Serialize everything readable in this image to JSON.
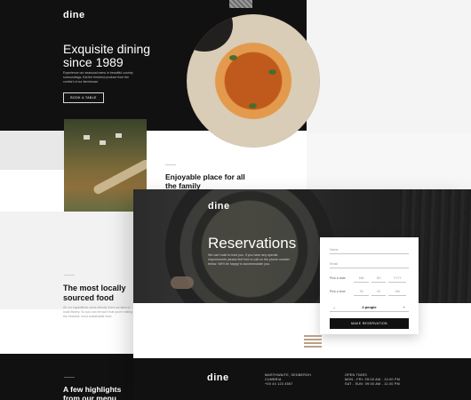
{
  "home": {
    "logo": "dine",
    "hero_title": "Exquisite dining since 1989",
    "hero_description": "Experience our seasonal menu in beautiful country surroundings. Eat the freshest produce from the comfort of our farmhouse.",
    "book_button": "BOOK A TABLE",
    "about_title": "Enjoyable place for all the family",
    "food_title": "The most locally sourced food",
    "food_description": "All our ingredients come directly from our farm or local fishery. So you can be sure that you're eating the freshest, most sustainable food.",
    "highlights_title": "A few highlights from our menu"
  },
  "reservations": {
    "logo": "dine",
    "title": "Reservations",
    "description": "We can't wait to host you. If you have any special requirements please feel free to call on the phone number below. We'll be happy to accommodate you.",
    "form": {
      "name_placeholder": "Name",
      "email_placeholder": "Email",
      "date_label": "Pick a date",
      "date_fields": [
        "MM",
        "DD",
        "YYYY"
      ],
      "time_label": "Pick a time",
      "time_fields": [
        "09",
        "00",
        "AM"
      ],
      "people_value": "2 people",
      "people_minus": "–",
      "people_plus": "+",
      "submit_label": "MAKE RESERVATION"
    }
  },
  "footer": {
    "logo": "dine",
    "address_line1": "MARTHWAITE, SEDBERGH",
    "address_line2": "CUMBRIA",
    "phone": "+00 44 123 4567",
    "hours_title": "OPEN TIMES",
    "hours_weekdays": "MON - FRI: 09:00 AM - 10:00 PM",
    "hours_weekend": "SAT - SUN: 09:00 AM - 11:30 PM"
  },
  "colors": {
    "dark": "#111111",
    "accent": "#b9a185",
    "white": "#ffffff"
  }
}
